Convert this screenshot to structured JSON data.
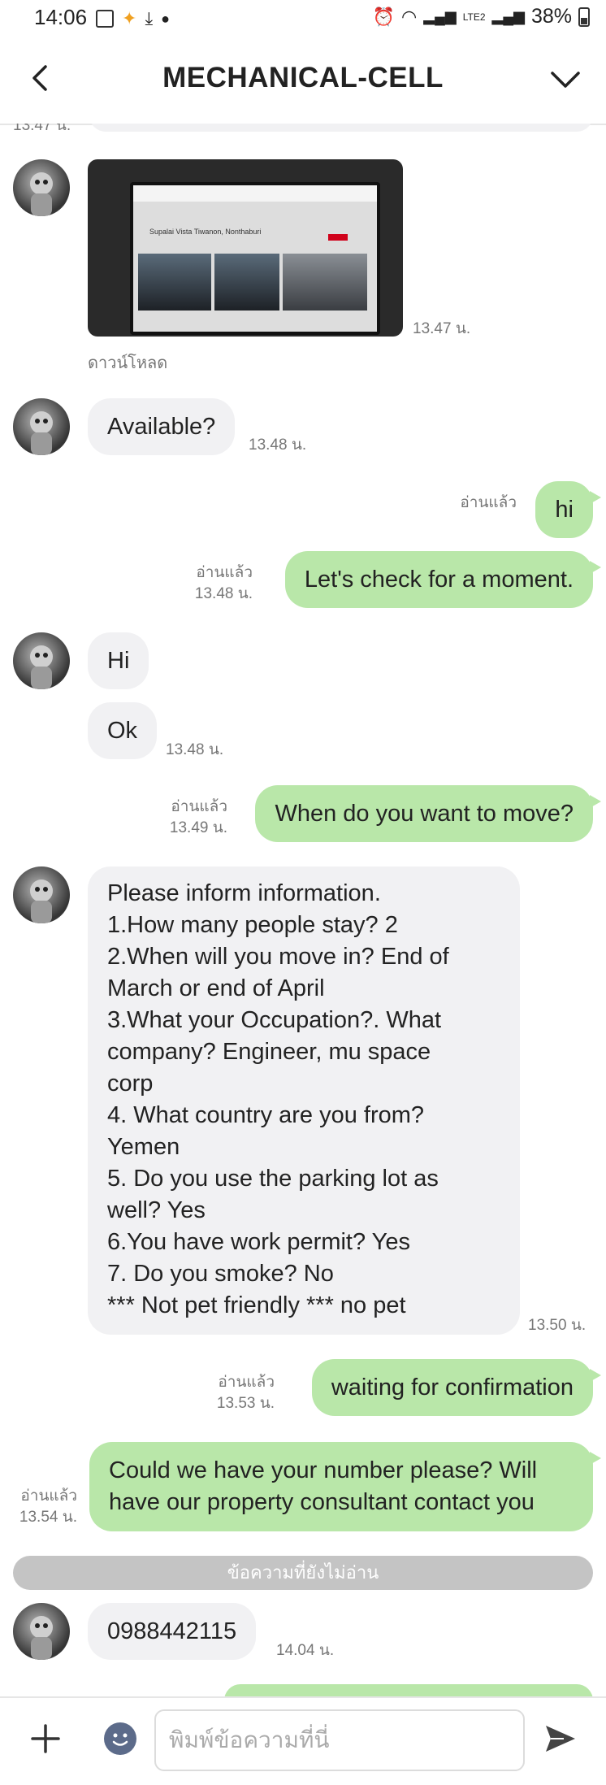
{
  "status_bar": {
    "time": "14:06",
    "battery": "38%",
    "network": "LTE2",
    "icons": [
      "gallery-icon",
      "app-icon",
      "download-icon",
      "dot-icon",
      "alarm-icon",
      "wifi-icon",
      "signal-icon",
      "battery-icon"
    ]
  },
  "header": {
    "title": "MECHANICAL-CELL",
    "back_icon": "chevron-left-icon",
    "menu_icon": "chevron-down-icon"
  },
  "chat": {
    "partial_top_time": "13.47 น.",
    "photo": {
      "time": "13.47 น.",
      "download_label": "ดาวน์โหลด",
      "screen_title": "Supalai Vista Tiwanon, Nonthaburi"
    },
    "messages": [
      {
        "id": "m1",
        "dir": "in",
        "text": "Available?",
        "time": "13.48 น."
      },
      {
        "id": "m2",
        "dir": "out",
        "text": "hi",
        "read": "อ่านแล้ว"
      },
      {
        "id": "m3",
        "dir": "out",
        "text": "Let's check for a moment.",
        "read": "อ่านแล้ว",
        "time": "13.48 น."
      },
      {
        "id": "m4",
        "dir": "in",
        "text": "Hi"
      },
      {
        "id": "m5",
        "dir": "in",
        "text": "Ok",
        "time": "13.48 น."
      },
      {
        "id": "m6",
        "dir": "out",
        "text": "When do you want to move?",
        "read": "อ่านแล้ว",
        "time": "13.49 น."
      },
      {
        "id": "m7",
        "dir": "in",
        "lines": [
          "Please inform information.",
          "1.How many people stay? 2",
          "2.When will you move in? End of",
          "March or end of April",
          "3.What your Occupation?. What",
          "company? Engineer, mu space",
          "corp",
          "4. What country are you from?",
          "Yemen",
          "5. Do you use the parking lot as",
          "well? Yes",
          "6.You have work permit? Yes",
          "7. Do you smoke? No",
          "*** Not pet friendly *** no pet"
        ],
        "time": "13.50 น."
      },
      {
        "id": "m8",
        "dir": "out",
        "text": "waiting for confirmation",
        "read": "อ่านแล้ว",
        "time": "13.53 น."
      },
      {
        "id": "m9",
        "dir": "out",
        "lines": [
          "Could we have your number please? Will",
          "have our property consultant contact you"
        ],
        "read": "อ่านแล้ว",
        "time": "13.54 น."
      },
      {
        "id": "m10",
        "dir": "in",
        "text": "0988442115",
        "time": "14.04 น."
      }
    ],
    "unread_divider": "ข้อความที่ยังไม่อ่าน"
  },
  "input_bar": {
    "placeholder": "พิมพ์ข้อความที่นี่",
    "plus_icon": "plus-icon",
    "emoji_icon": "emoji-icon",
    "send_icon": "send-icon"
  },
  "colors": {
    "outgoing_bubble": "#b9e7a9",
    "incoming_bubble": "#f1f1f3",
    "divider": "#c4c4c4"
  }
}
